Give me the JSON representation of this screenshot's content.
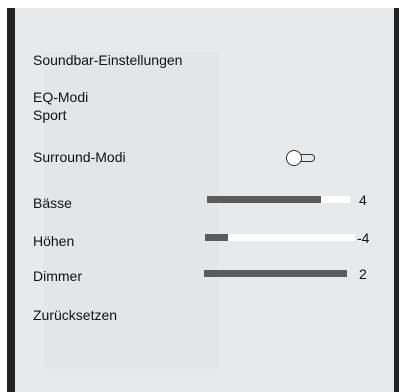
{
  "menu": {
    "title": "Soundbar-Einstellungen",
    "eq": {
      "label": "EQ-Modi",
      "value": "Sport"
    },
    "surround": {
      "label": "Surround-Modi",
      "enabled": false
    },
    "bass": {
      "label": "Bässe",
      "value": "4",
      "fill_fraction": 0.8
    },
    "treble": {
      "label": "Höhen",
      "value": "-4",
      "fill_fraction": 0.15
    },
    "dimmer": {
      "label": "Dimmer",
      "value": "2",
      "fill_fraction": 1.0
    },
    "reset": {
      "label": "Zurücksetzen"
    }
  },
  "colors": {
    "panel": "#e8e9eb",
    "frame": "#222222",
    "slider_fill": "#5b5b5b",
    "slider_track": "#ffffff"
  }
}
